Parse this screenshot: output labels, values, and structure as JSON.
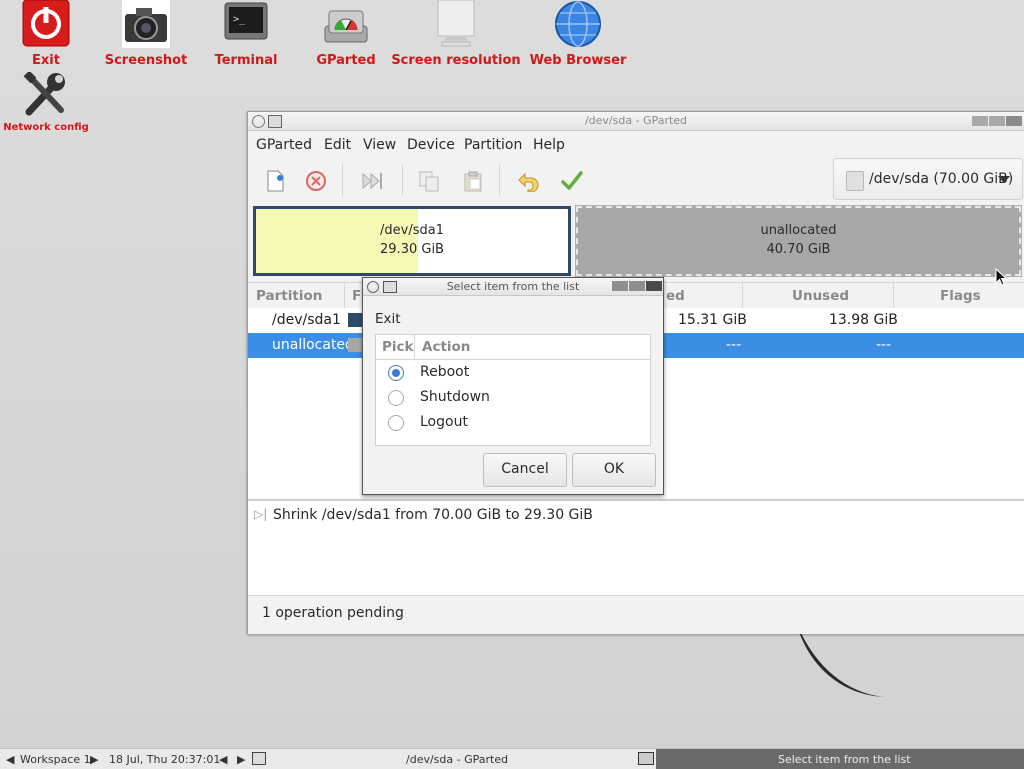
{
  "desktop": {
    "icons": [
      {
        "label": "Exit",
        "icon": "power-icon"
      },
      {
        "label": "Screenshot",
        "icon": "camera-icon"
      },
      {
        "label": "Terminal",
        "icon": "terminal-icon"
      },
      {
        "label": "GParted",
        "icon": "gparted-icon"
      },
      {
        "label": "Screen resolution",
        "icon": "monitor-icon"
      },
      {
        "label": "Web Browser",
        "icon": "globe-icon"
      },
      {
        "label": "Network config",
        "icon": "tools-icon"
      }
    ]
  },
  "window": {
    "title": "/dev/sda - GParted",
    "menu": [
      "GParted",
      "Edit",
      "View",
      "Device",
      "Partition",
      "Help"
    ],
    "toolbar": [
      "new-partition-icon",
      "delete-icon",
      "resize-move-icon",
      "copy-icon",
      "paste-icon",
      "undo-icon",
      "apply-icon"
    ],
    "device_selector": "/dev/sda (70.00 GiB)",
    "graphic": {
      "p1": {
        "name": "/dev/sda1",
        "size": "29.30 GiB",
        "used_fraction": 0.52
      },
      "p2": {
        "name": "unallocated",
        "size": "40.70 GiB"
      }
    },
    "columns": {
      "partition": "Partition",
      "fs": "Fi",
      "used": "ed",
      "unused": "Unused",
      "flags": "Flags"
    },
    "rows": [
      {
        "partition": "/dev/sda1",
        "used": "15.31 GiB",
        "unused": "13.98 GiB",
        "flags": "",
        "color": "#2e4a66"
      },
      {
        "partition": "unallocated",
        "used": "---",
        "unused": "---",
        "flags": "",
        "color": "#a7a7a7"
      }
    ],
    "operations": [
      "Shrink /dev/sda1 from 70.00 GiB to 29.30 GiB"
    ],
    "status": "1 operation pending"
  },
  "dialog": {
    "title": "Select item from the list",
    "heading": "Exit",
    "columns": {
      "pick": "Pick",
      "action": "Action"
    },
    "options": [
      {
        "label": "Reboot",
        "selected": true
      },
      {
        "label": "Shutdown",
        "selected": false
      },
      {
        "label": "Logout",
        "selected": false
      }
    ],
    "cancel": "Cancel",
    "ok": "OK"
  },
  "taskbar": {
    "workspace": "Workspace 1",
    "clock": "18 Jul, Thu 20:37:01",
    "tasks": [
      "/dev/sda - GParted",
      "Select item from the list"
    ]
  },
  "colors": {
    "accent": "#3a8ee6",
    "label_red": "#d01818",
    "partition_border": "#2e4a66",
    "unallocated": "#a7a7a7",
    "used": "#f7f7b5"
  }
}
